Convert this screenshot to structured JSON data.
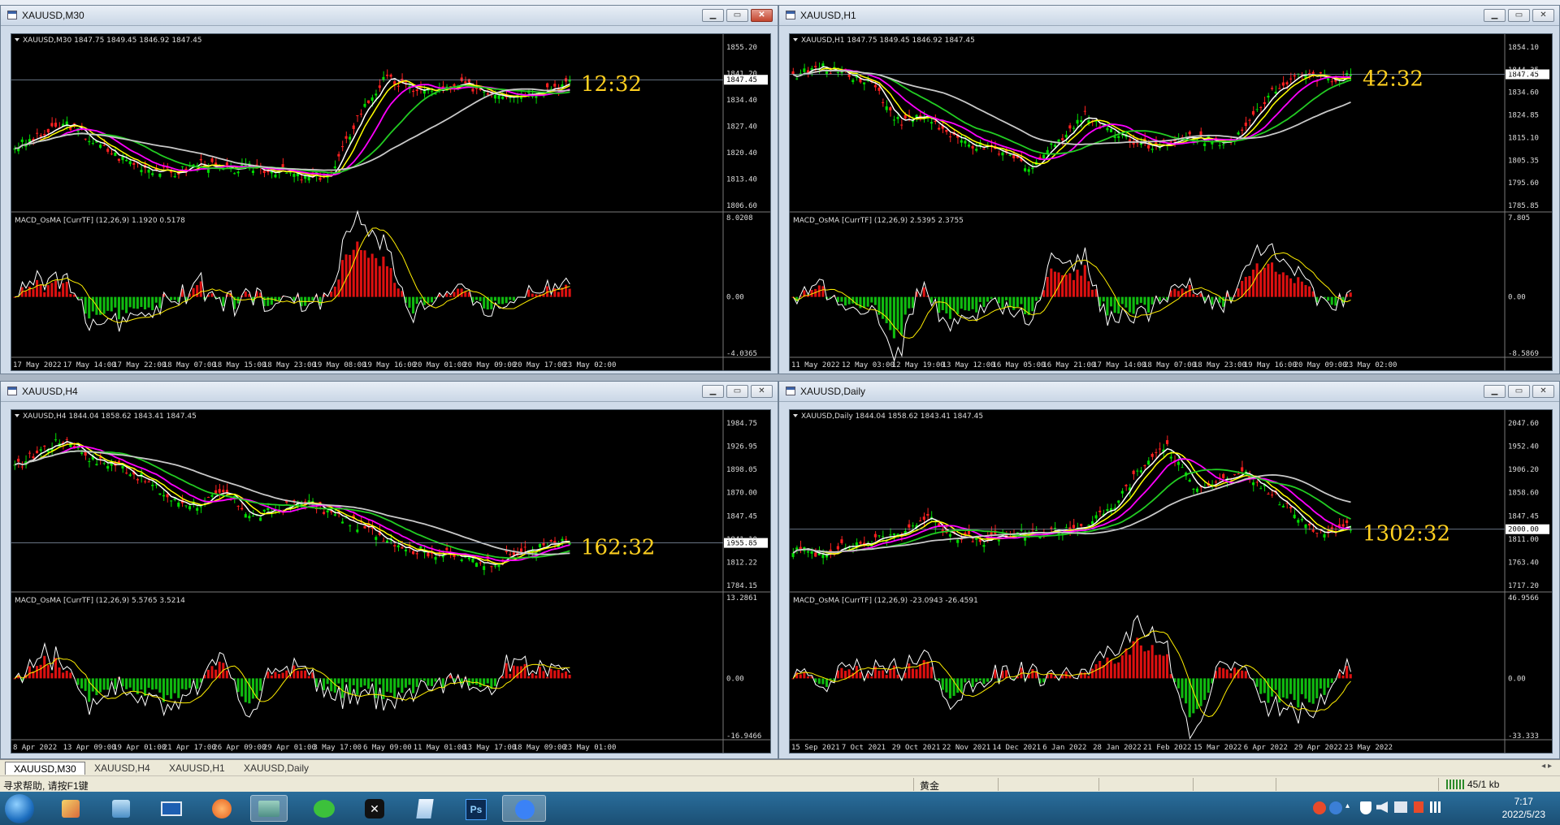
{
  "windows": [
    {
      "title": "XAUUSD,M30",
      "ohlc": "XAUUSD,M30  1847.75 1849.45 1846.92 1847.45",
      "macd_label": "MACD_OsMA [CurrTF] (12,26,9) 1.1920 0.5178",
      "countdown": "12:32",
      "price_ticks": [
        "1855.20",
        "1847.45",
        "1841.20",
        "1834.40",
        "1827.40",
        "1820.40",
        "1813.40",
        "1806.60"
      ],
      "macd_ticks": [
        "8.0208",
        "0.00",
        "-4.0365"
      ],
      "time_ticks": [
        "17 May 2022",
        "17 May 14:00",
        "17 May 22:00",
        "18 May 07:00",
        "18 May 15:00",
        "18 May 23:00",
        "19 May 08:00",
        "19 May 16:00",
        "20 May 01:00",
        "20 May 09:00",
        "20 May 17:00",
        "23 May 02:00"
      ]
    },
    {
      "title": "XAUUSD,H1",
      "ohlc": "XAUUSD,H1  1847.75 1849.45 1846.92 1847.45",
      "macd_label": "MACD_OsMA [CurrTF] (12,26,9) 2.5395 2.3755",
      "countdown": "42:32",
      "price_ticks": [
        "1854.10",
        "1847.45",
        "1844.35",
        "1834.60",
        "1824.85",
        "1815.10",
        "1805.35",
        "1795.60",
        "1785.85"
      ],
      "macd_ticks": [
        "7.805",
        "0.00",
        "-8.5869"
      ],
      "time_ticks": [
        "11 May 2022",
        "12 May 03:00",
        "12 May 19:00",
        "13 May 12:00",
        "16 May 05:00",
        "16 May 21:00",
        "17 May 14:00",
        "18 May 07:00",
        "18 May 23:00",
        "19 May 16:00",
        "20 May 09:00",
        "23 May 02:00"
      ]
    },
    {
      "title": "XAUUSD,H4",
      "ohlc": "XAUUSD,H4  1844.04 1858.62 1843.41 1847.45",
      "macd_label": "MACD_OsMA [CurrTF] (12,26,9) 5.5765 3.5214",
      "countdown": "162:32",
      "price_ticks": [
        "1984.75",
        "1955.85",
        "1926.95",
        "1898.05",
        "1870.00",
        "1847.45",
        "1841.10",
        "1812.22",
        "1784.15"
      ],
      "macd_ticks": [
        "13.2861",
        "0.00",
        "-16.9466"
      ],
      "time_ticks": [
        "8 Apr 2022",
        "13 Apr 09:00",
        "19 Apr 01:00",
        "21 Apr 17:00",
        "26 Apr 09:00",
        "29 Apr 01:00",
        "3 May 17:00",
        "6 May 09:00",
        "11 May 01:00",
        "13 May 17:00",
        "18 May 09:00",
        "23 May 01:00"
      ]
    },
    {
      "title": "XAUUSD,Daily",
      "ohlc": "XAUUSD,Daily  1844.04 1858.62 1843.41 1847.45",
      "macd_label": "MACD_OsMA [CurrTF] (12,26,9) -23.0943 -26.4591",
      "countdown": "1302:32",
      "price_ticks": [
        "2047.60",
        "2000.00",
        "1952.40",
        "1906.20",
        "1858.60",
        "1847.45",
        "1811.00",
        "1763.40",
        "1717.20"
      ],
      "macd_ticks": [
        "46.9566",
        "0.00",
        "-33.333"
      ],
      "time_ticks": [
        "15 Sep 2021",
        "7 Oct 2021",
        "29 Oct 2021",
        "22 Nov 2021",
        "14 Dec 2021",
        "6 Jan 2022",
        "28 Jan 2022",
        "21 Feb 2022",
        "15 Mar 2022",
        "6 Apr 2022",
        "29 Apr 2022",
        "23 May 2022"
      ]
    }
  ],
  "tabs": [
    "XAUUSD,M30",
    "XAUUSD,H4",
    "XAUUSD,H1",
    "XAUUSD,Daily"
  ],
  "status": {
    "help": "寻求帮助, 请按F1键",
    "symbol": "黄金",
    "traffic": "45/1 kb"
  },
  "clock": {
    "time": "7:17",
    "date": "2022/5/23"
  },
  "colors": {
    "bull": "#00dd00",
    "bear": "#ff2020",
    "ma1": "#ffffff",
    "ma2": "#ffff00",
    "ma3": "#ff00ff",
    "ma4": "#22cc22",
    "ma5": "#c8c8c8",
    "hist_up": "#dd1010",
    "hist_down": "#10bb10",
    "countdown": "#ffd020"
  },
  "taskbar_icons": [
    "start-orb-icon",
    "paint-icon",
    "user-accounts-icon",
    "desktop-icon",
    "player-icon",
    "metatrader-icon",
    "wechat-icon",
    "capcut-icon",
    "notepad-icon",
    "photoshop-icon",
    "feishu-icon"
  ]
}
